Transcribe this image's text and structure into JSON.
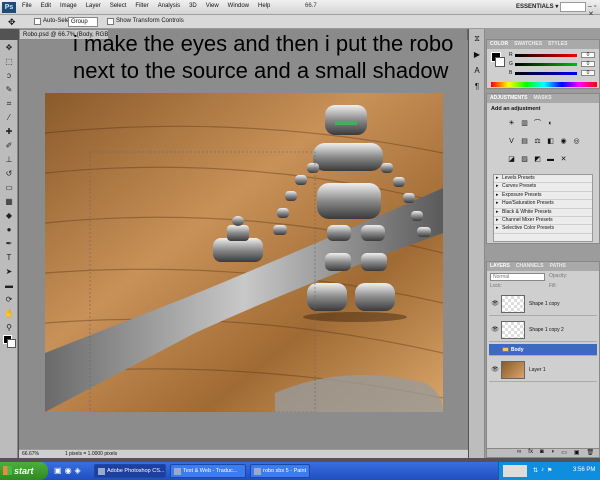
{
  "menubar": {
    "logo": "Ps",
    "menus": [
      "File",
      "Edit",
      "Image",
      "Layer",
      "Select",
      "Filter",
      "Analysis",
      "3D",
      "View",
      "Window",
      "Help"
    ],
    "zoom_readout": "66.7",
    "workspace": "ESSENTIALS ▾",
    "window_buttons": "– ▫ ✕"
  },
  "optionsbar": {
    "auto_select_label": "Auto-Select:",
    "auto_select_value": "Group",
    "show_transform_label": "Show Transform Controls"
  },
  "document": {
    "tab_title": "Robo.psd @ 66.7% (Body, RGB/8)",
    "status_zoom": "66.67%",
    "status_info": "1 pixels = 1.0000 pixels",
    "overlay_text": "i make the eyes and then i put the robo next to the source and a small shadow"
  },
  "color_panel": {
    "tabs": [
      "COLOR",
      "SWATCHES",
      "STYLES"
    ],
    "channels": [
      {
        "name": "R",
        "value": "0",
        "gradient": "#ff0000"
      },
      {
        "name": "G",
        "value": "0",
        "gradient": "#00c000"
      },
      {
        "name": "B",
        "value": "0",
        "gradient": "#0000ff"
      }
    ]
  },
  "adjustments_panel": {
    "tabs": [
      "ADJUSTMENTS",
      "MASKS"
    ],
    "title": "Add an adjustment",
    "presets": [
      "Levels Presets",
      "Curves Presets",
      "Exposure Presets",
      "Hue/Saturation Presets",
      "Black & White Presets",
      "Channel Mixer Presets",
      "Selective Color Presets"
    ]
  },
  "layers_panel": {
    "tabs": [
      "LAYERS",
      "CHANNELS",
      "PATHS"
    ],
    "blend_mode": "Normal",
    "opacity_label": "Opacity:",
    "lock_label": "Lock:",
    "fill_label": "Fill:",
    "layers": [
      {
        "name": "Shape 1 copy",
        "kind": "layer",
        "visible": true
      },
      {
        "name": "Shape 1 copy 2",
        "kind": "layer",
        "visible": true
      },
      {
        "name": "Body",
        "kind": "group",
        "visible": false,
        "selected": true
      },
      {
        "name": "Layer 1",
        "kind": "layer",
        "visible": true
      }
    ]
  },
  "taskbar": {
    "start_label": "start",
    "tasks": [
      {
        "label": "Adobe Photoshop CS...",
        "active": true
      },
      {
        "label": "Text & Web - Traduc...",
        "active": false
      },
      {
        "label": "robo sbs 5 - Paint",
        "active": false
      }
    ],
    "clock": "3:56 PM"
  },
  "colors": {
    "selected_layer": "#3d6ac0",
    "taskbar": "#1f4ec0"
  }
}
